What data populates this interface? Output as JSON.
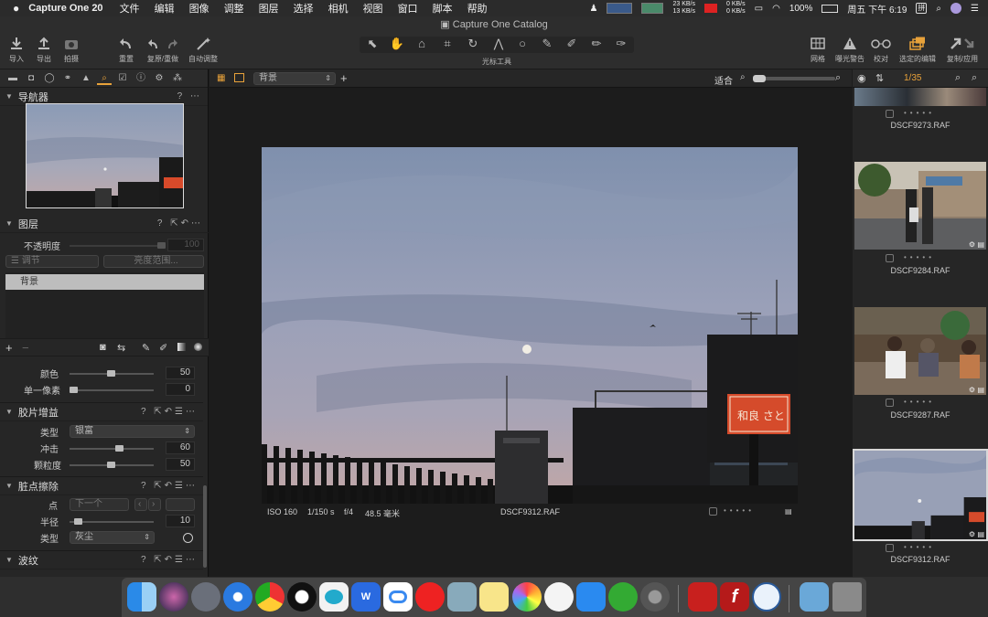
{
  "menubar": {
    "app_name": "Capture One 20",
    "items": [
      "文件",
      "编辑",
      "图像",
      "调整",
      "图层",
      "选择",
      "相机",
      "视图",
      "窗口",
      "脚本",
      "帮助"
    ],
    "net_up": "23 KB/s",
    "net_down": "13 KB/s",
    "net2_up": "0 KB/s",
    "net2_down": "0 KB/s",
    "battery": "100%",
    "clock": "周五 下午 6:19"
  },
  "window": {
    "title": "Capture One Catalog"
  },
  "toolbar": {
    "import": "导入",
    "export": "导出",
    "capture": "拍摄",
    "reset": "重置",
    "undo_redo": "复原/重做",
    "auto_adjust": "自动调整",
    "cursor_tools": "光标工具",
    "grid": "网格",
    "exposure_warning": "曝光警告",
    "proof": "校对",
    "edit_selected": "选定的编辑",
    "copy_apply": "复制/应用"
  },
  "navigator": {
    "title": "导航器"
  },
  "layers": {
    "title": "图层",
    "opacity_label": "不透明度",
    "opacity_value": "100",
    "adjust_dropdown": "调节",
    "luma_range_button": "亮度范围...",
    "background_layer": "背景"
  },
  "color_section": {
    "color_label": "颜色",
    "color_value": "50",
    "single_pixel_label": "单一像素",
    "single_pixel_value": "0"
  },
  "film_grain": {
    "title": "胶片增益",
    "type_label": "类型",
    "type_value": "银富",
    "impact_label": "冲击",
    "impact_value": "60",
    "granularity_label": "颗粒度",
    "granularity_value": "50",
    "impact_fraction": 0.6,
    "granularity_fraction": 0.5
  },
  "spot_removal": {
    "title": "脏点擦除",
    "spot_label": "点",
    "spot_value": "下一个",
    "radius_label": "半径",
    "radius_value": "10",
    "type_label": "类型",
    "type_value": "灰尘"
  },
  "moire": {
    "title": "波纹"
  },
  "viewer": {
    "layer_select": "背景",
    "fit_label": "适合",
    "iso": "ISO 160",
    "shutter": "1/150 s",
    "aperture": "f/4",
    "focal": "48.5 毫米",
    "filename": "DSCF9312.RAF"
  },
  "browser": {
    "count": "1/35",
    "thumbs": [
      {
        "name": "DSCF9273.RAF"
      },
      {
        "name": "DSCF9284.RAF"
      },
      {
        "name": "DSCF9287.RAF"
      },
      {
        "name": "DSCF9312.RAF"
      }
    ]
  },
  "photo": {
    "sign_text": "和良 さと"
  },
  "colors": {
    "accent": "#e8a23a",
    "panel": "#262626",
    "selected_thumb_border": "#d8d8d8"
  }
}
